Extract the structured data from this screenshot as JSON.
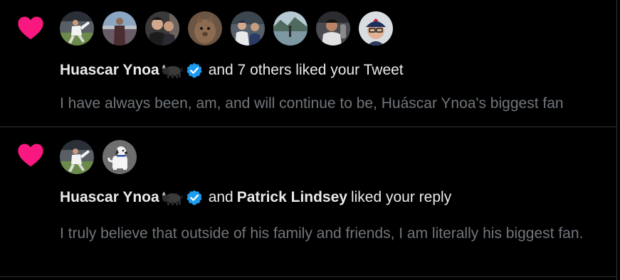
{
  "notifications": [
    {
      "id": "n1",
      "type_icon": "heart-icon",
      "avatars": [
        {
          "name": "avatar-pitcher-throwing"
        },
        {
          "name": "avatar-stadium-person"
        },
        {
          "name": "avatar-two-men"
        },
        {
          "name": "avatar-animal"
        },
        {
          "name": "avatar-baseball-fans"
        },
        {
          "name": "avatar-lake-mountains"
        },
        {
          "name": "avatar-player-smiling"
        },
        {
          "name": "avatar-man-cap-glasses"
        }
      ],
      "actor": "Huascar Ynoa",
      "actor_emoji": "bull-emoji",
      "headline_rest": "and 7 others liked your Tweet",
      "tweet_text": "I have always been, am, and will continue to be, Huáscar Ynoa's biggest fan"
    },
    {
      "id": "n2",
      "type_icon": "heart-icon",
      "avatars": [
        {
          "name": "avatar-pitcher-throwing"
        },
        {
          "name": "avatar-white-dog"
        }
      ],
      "actor": "Huascar Ynoa",
      "actor_emoji": "bull-emoji",
      "connector": "and",
      "second_actor": "Patrick Lindsey",
      "headline_rest": "liked your reply",
      "tweet_text": "I truly believe that outside of his family and friends, I am literally his biggest fan."
    }
  ],
  "colors": {
    "background": "#000000",
    "heart": "#f91880",
    "verified": "#1d9bf0",
    "primary_text": "#e7e9ea",
    "secondary_text": "#71767b",
    "divider": "#2f3336"
  }
}
